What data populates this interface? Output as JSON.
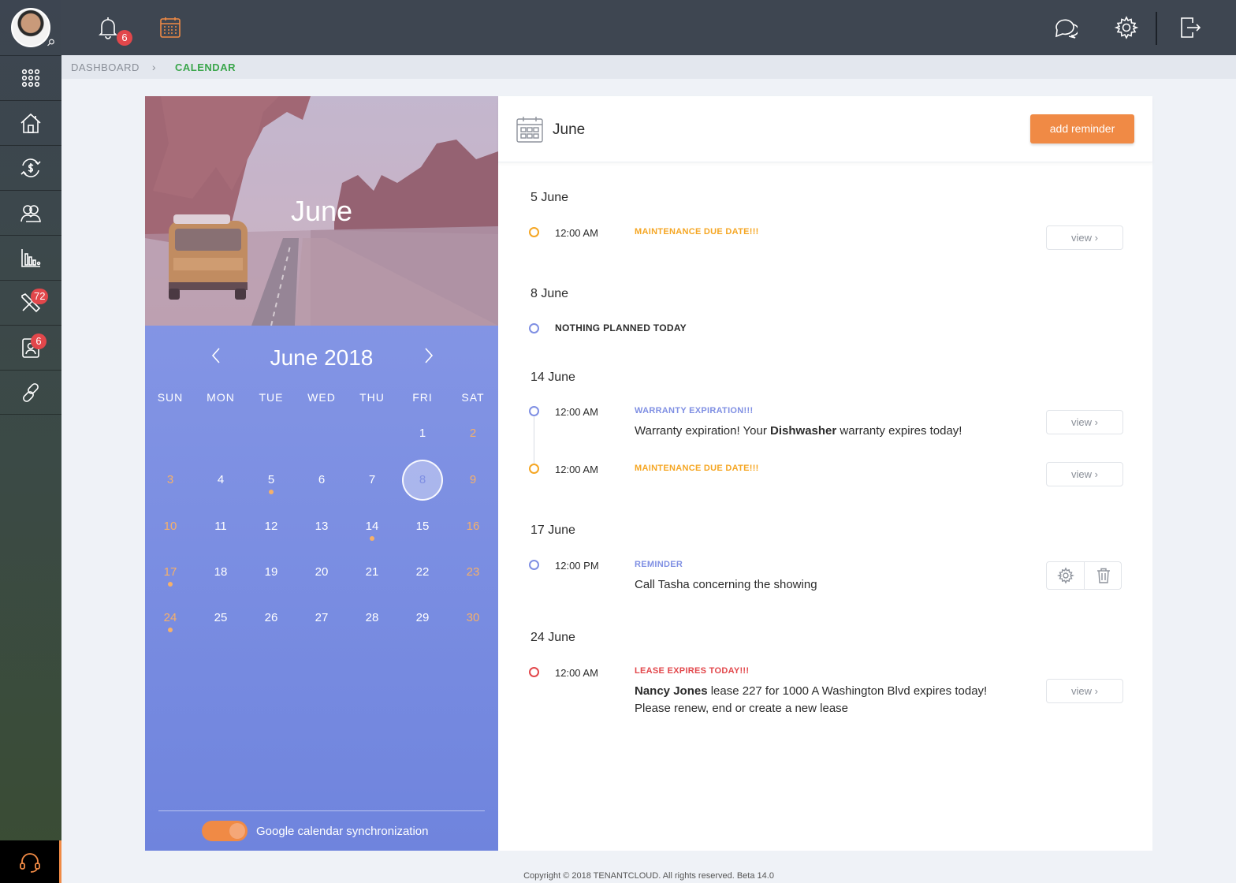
{
  "topbar": {
    "notification_count": "6"
  },
  "sidebar": {
    "items": [
      {
        "name": "apps",
        "badge": ""
      },
      {
        "name": "properties",
        "badge": ""
      },
      {
        "name": "accounting",
        "badge": ""
      },
      {
        "name": "contacts",
        "badge": ""
      },
      {
        "name": "reports",
        "badge": ""
      },
      {
        "name": "maintenance",
        "badge": "72"
      },
      {
        "name": "applications",
        "badge": "6"
      },
      {
        "name": "integrations",
        "badge": ""
      }
    ]
  },
  "breadcrumb": {
    "parent": "DASHBOARD",
    "current": "CALENDAR"
  },
  "calendar": {
    "photo_title": "June",
    "month": "June",
    "year": "2018",
    "weekdays": [
      "SUN",
      "MON",
      "TUE",
      "WED",
      "THU",
      "FRI",
      "SAT"
    ],
    "first_weekday_index": 5,
    "days_in_month": 30,
    "selected_day": 8,
    "event_days": [
      5,
      14,
      17,
      24
    ],
    "sync_label": "Google calendar synchronization",
    "sync_enabled": true
  },
  "agenda": {
    "title": "June",
    "add_button": "add reminder",
    "view_label": "view ›",
    "days": [
      {
        "heading": "5  June",
        "events": [
          {
            "time": "12:00 AM",
            "type": "MAINTENANCE DUE DATE!!!",
            "color": "#f5a623",
            "desc": "",
            "action": "view"
          }
        ]
      },
      {
        "heading": "8  June",
        "events": [
          {
            "time": "",
            "type": "NOTHING PLANNED TODAY",
            "color": "#7f8fe3",
            "desc": "",
            "action": "none"
          }
        ]
      },
      {
        "heading": "14  June",
        "events": [
          {
            "time": "12:00 AM",
            "type": "WARRANTY EXPIRATION!!!",
            "color": "#7f8fe3",
            "desc_pre": "Warranty expiration! Your ",
            "desc_bold": "Dishwasher",
            "desc_post": " warranty expires today!",
            "action": "view"
          },
          {
            "time": "12:00 AM",
            "type": "MAINTENANCE DUE DATE!!!",
            "color": "#f5a623",
            "desc": "",
            "action": "view"
          }
        ]
      },
      {
        "heading": "17  June",
        "events": [
          {
            "time": "12:00 PM",
            "type": "REMINDER",
            "color": "#7f8fe3",
            "desc": "Call Tasha concerning the showing",
            "action": "edit-delete"
          }
        ]
      },
      {
        "heading": "24  June",
        "events": [
          {
            "time": "12:00 AM",
            "type": "LEASE EXPIRES TODAY!!!",
            "color": "#e2474b",
            "desc_bold": "Nancy Jones",
            "desc_post": " lease 227 for 1000 A Washington Blvd expires today!",
            "desc_line2": "Please renew, end or create a new lease",
            "action": "view"
          }
        ]
      }
    ]
  },
  "footer": {
    "text": "Copyright © 2018 TENANTCLOUD. All rights reserved. Beta 14.0"
  }
}
